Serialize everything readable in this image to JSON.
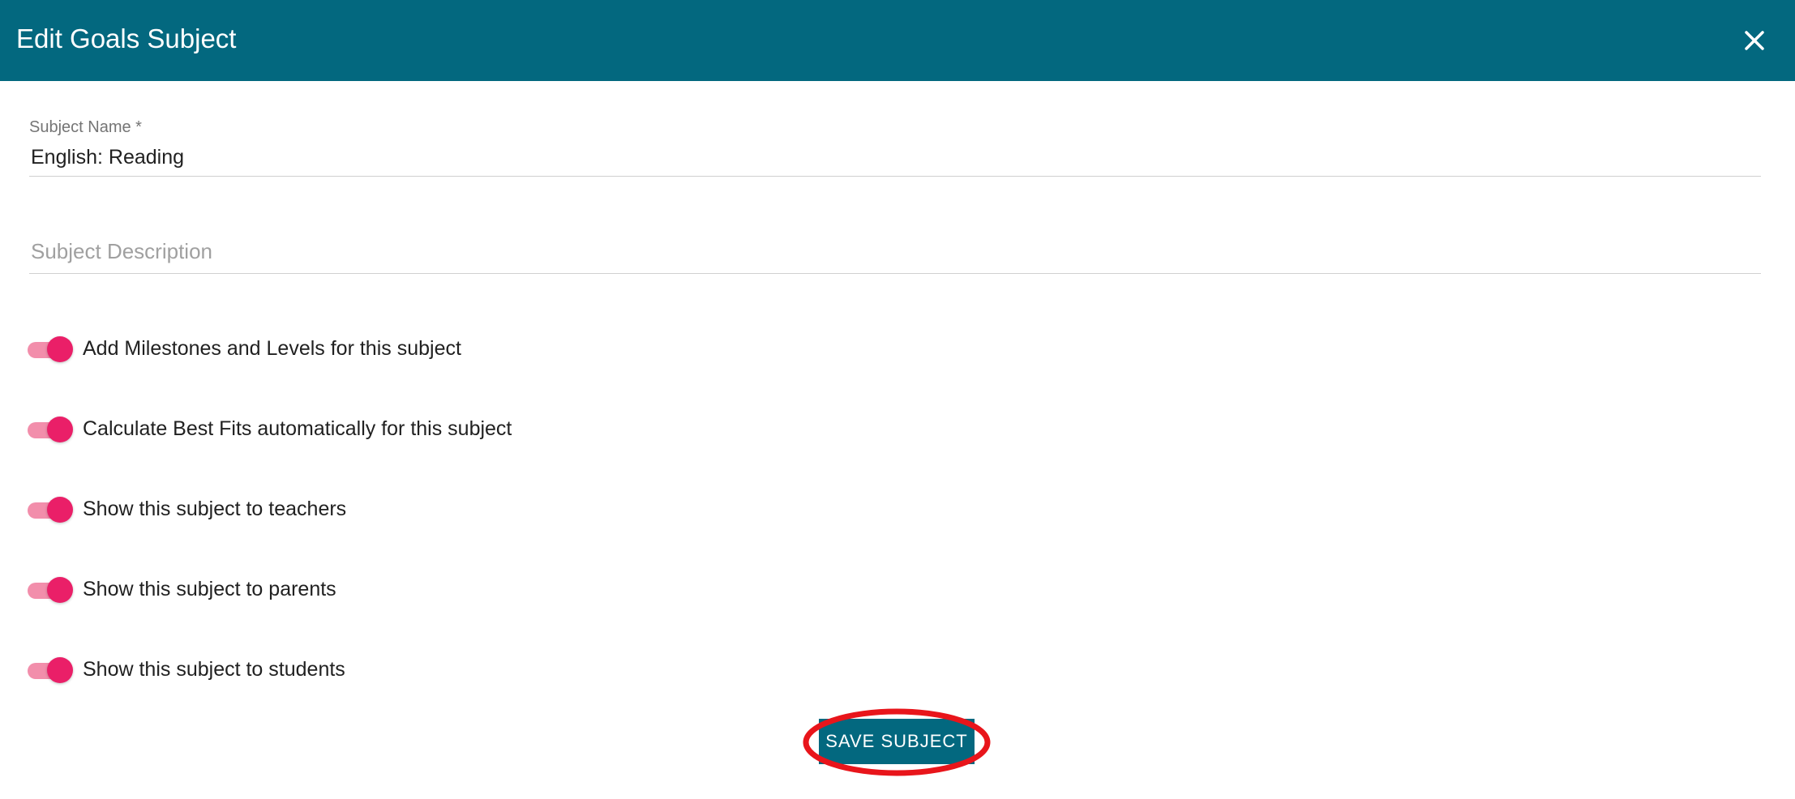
{
  "dialog": {
    "title": "Edit Goals Subject",
    "close_icon": "close-icon"
  },
  "form": {
    "subject_name": {
      "label": "Subject Name *",
      "value": "English: Reading"
    },
    "subject_description": {
      "placeholder": "Subject Description",
      "value": ""
    }
  },
  "toggles": [
    {
      "label": "Add Milestones and Levels for this subject",
      "on": true
    },
    {
      "label": "Calculate Best Fits automatically for this subject",
      "on": true
    },
    {
      "label": "Show this subject to teachers",
      "on": true
    },
    {
      "label": "Show this subject to parents",
      "on": true
    },
    {
      "label": "Show this subject to students",
      "on": true
    }
  ],
  "actions": {
    "save_label": "SAVE SUBJECT"
  },
  "colors": {
    "header_bg": "#03687f",
    "toggle_thumb": "#ea1f68",
    "toggle_track": "#f28eab",
    "highlight_ring": "#e8151b"
  }
}
